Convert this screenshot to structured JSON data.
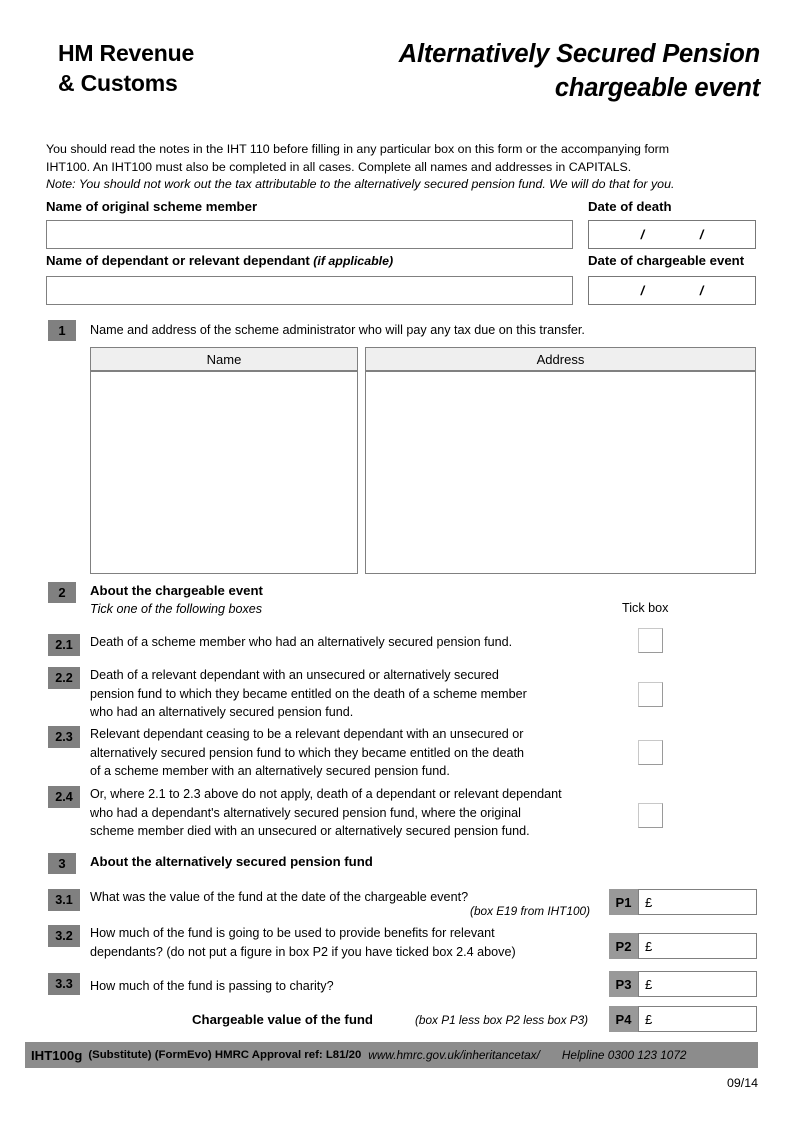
{
  "header": {
    "org_line1": "HM Revenue",
    "org_line2": "& Customs",
    "title_line1": "Alternatively Secured Pension",
    "title_line2": "chargeable event"
  },
  "intro": {
    "line1": "You should read the notes in the IHT 110 before filling in any particular box on this form or the accompanying form",
    "line2": "IHT100.  An IHT100 must also be completed in all cases. Complete all names and addresses in CAPITALS.",
    "note": "Note: You should not work out the tax attributable to the alternatively secured pension fund. We will do that for you."
  },
  "person_fields": {
    "member_label": "Name of original scheme member",
    "member_value": "",
    "death_label": "Date of death",
    "death_value": "/     /",
    "dependant_label": "Name of dependant or relevant dependant",
    "dependant_label_italic": "(if applicable)",
    "dependant_value": "",
    "event_date_label": "Date of chargeable event",
    "event_date_value": "/     /"
  },
  "section1": {
    "number": "1",
    "instruction": "Name and address of the scheme administrator who will pay any tax due on this transfer.",
    "col_name_header": "Name",
    "col_address_header": "Address",
    "name_value": "",
    "address_value": ""
  },
  "section2": {
    "number": "2",
    "heading": "About the chargeable event",
    "subheading": "Tick one of the following boxes",
    "tick_column_label": "Tick box",
    "options": [
      {
        "number": "2.1",
        "lines": [
          "Death of a scheme member who had an alternatively secured pension fund."
        ],
        "checked": false
      },
      {
        "number": "2.2",
        "lines": [
          "Death of a relevant dependant with an unsecured or alternatively secured",
          "pension fund to which they became entitled on the death of a scheme member",
          "who had an alternatively secured pension fund."
        ],
        "checked": false
      },
      {
        "number": "2.3",
        "lines": [
          "Relevant dependant ceasing to be a relevant dependant with an unsecured or",
          "alternatively secured pension fund to which they became entitled on the death",
          "of a scheme member with an alternatively secured pension fund."
        ],
        "checked": false
      },
      {
        "number": "2.4",
        "lines": [
          "Or, where 2.1 to 2.3 above do not apply, death of a dependant or relevant dependant",
          "who had a dependant's alternatively secured pension fund, where the original",
          "scheme member died with an unsecured or alternatively secured pension fund."
        ],
        "checked": false
      }
    ]
  },
  "section3": {
    "number": "3",
    "heading": "About the alternatively secured pension fund",
    "q31": {
      "number": "3.1",
      "line1": "What was the value of the fund at the date of the chargeable event?",
      "ref": "(box E19 from IHT100)",
      "box_code": "P1",
      "currency": "£",
      "value": ""
    },
    "q32": {
      "number": "3.2",
      "line1": "How much of the fund is going to be used to provide benefits for relevant",
      "line2": "dependants? (do not put a figure in box P2 if you have ticked box 2.4 above)",
      "box_code": "P2",
      "currency": "£",
      "value": ""
    },
    "q33": {
      "number": "3.3",
      "line1": "How much of the fund is passing to charity?",
      "box_code": "P3",
      "currency": "£",
      "value": ""
    },
    "total": {
      "label": "Chargeable value of the fund",
      "ref": "(box P1 less box P2 less box P3)",
      "box_code": "P4",
      "currency": "£",
      "value": ""
    }
  },
  "footer": {
    "code": "IHT100g",
    "subtitle": "(Substitute) (FormEvo) HMRC Approval ref: L81/20",
    "url": "www.hmrc.gov.uk/inheritancetax/",
    "helpline": "Helpline 0300 123 1072",
    "date": "09/14"
  }
}
